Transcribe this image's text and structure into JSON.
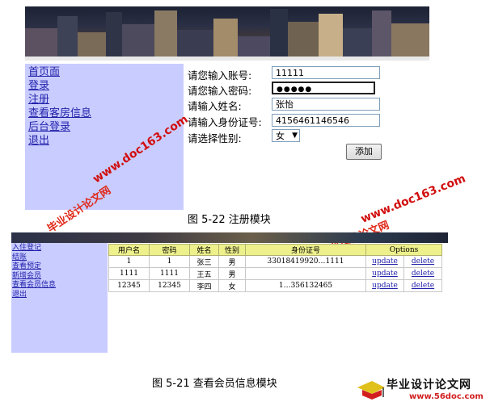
{
  "register_sidebar": {
    "items": [
      "首页面",
      "登录",
      "注册",
      "查看客房信息",
      "后台登录",
      "退出"
    ]
  },
  "register_form": {
    "account_label": "请您输入账号:",
    "account_value": "11111",
    "password_label": "请您输入密码:",
    "password_value": "●●●●●",
    "name_label": "请输入姓名:",
    "name_value": "张怡",
    "id_label": "请输入身份证号:",
    "id_value": "4156461146546",
    "gender_label": "请选择性别:",
    "gender_value": "女",
    "submit_label": "添加"
  },
  "caption_register": "图 5-22 注册模块",
  "member_sidebar": {
    "items": [
      "入住登记",
      "结账",
      "查看预定",
      "新增会员",
      "查看会员信息",
      "退出"
    ]
  },
  "member_table": {
    "headers": [
      "用户名",
      "密码",
      "姓名",
      "性别",
      "身份证号",
      "Options"
    ],
    "rows": [
      {
        "username": "1",
        "password": "1",
        "name": "张三",
        "gender": "男",
        "id_number": "33018419920…1111",
        "update": "update",
        "delete": "delete"
      },
      {
        "username": "1111",
        "password": "1111",
        "name": "王五",
        "gender": "男",
        "id_number": "",
        "update": "update",
        "delete": "delete"
      },
      {
        "username": "12345",
        "password": "12345",
        "name": "李四",
        "gender": "女",
        "id_number": "1…356132465",
        "update": "update",
        "delete": "delete"
      }
    ]
  },
  "caption_members": "图 5-21 查看会员信息模块",
  "watermark": {
    "cn": "毕业设计论文网",
    "en": "www.doc163.com"
  },
  "logo": {
    "title": "毕业设计论文网",
    "url": "www.56doc.com"
  },
  "colors": {
    "sidebar_bg": "#c9ccff",
    "link": "#2222aa",
    "table_header_bg": "#eef08c",
    "watermark": "#d10e0e"
  }
}
